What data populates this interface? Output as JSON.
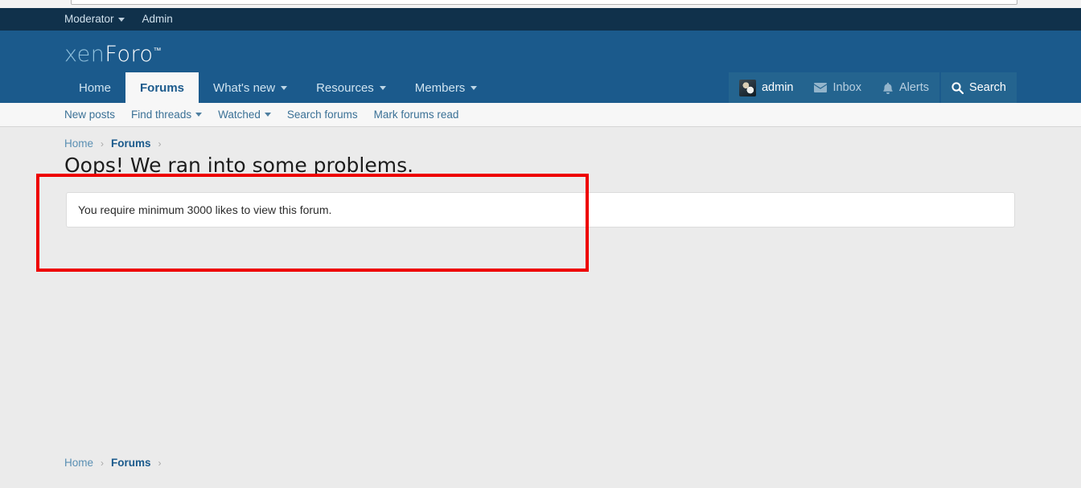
{
  "colors": {
    "staff_bar_bg": "#10314b",
    "header_bg": "#1b5a8c",
    "accent_blue": "#3b7196",
    "annotation_red": "#ee0000",
    "page_bg": "#ebebeb",
    "subnav_bg": "#f7f7f7"
  },
  "staff_bar": {
    "items": [
      {
        "label": "Moderator",
        "has_caret": true
      },
      {
        "label": "Admin",
        "has_caret": false
      }
    ]
  },
  "logo": {
    "part1": "xen",
    "part2": "Foro",
    "trademark": "™"
  },
  "nav": {
    "tabs": [
      {
        "label": "Home",
        "active": false,
        "has_caret": false
      },
      {
        "label": "Forums",
        "active": true,
        "has_caret": false
      },
      {
        "label": "What's new",
        "active": false,
        "has_caret": true
      },
      {
        "label": "Resources",
        "active": false,
        "has_caret": true
      },
      {
        "label": "Members",
        "active": false,
        "has_caret": true
      }
    ]
  },
  "visitor_menu": {
    "username": "admin",
    "avatar_icon": "user-avatar-image",
    "inbox_label": "Inbox",
    "inbox_icon": "envelope-icon",
    "alerts_label": "Alerts",
    "alerts_icon": "bell-icon",
    "search_label": "Search",
    "search_icon": "search-icon"
  },
  "sub_nav": {
    "items": [
      {
        "label": "New posts",
        "has_caret": false
      },
      {
        "label": "Find threads",
        "has_caret": true
      },
      {
        "label": "Watched",
        "has_caret": true
      },
      {
        "label": "Search forums",
        "has_caret": false
      },
      {
        "label": "Mark forums read",
        "has_caret": false
      }
    ]
  },
  "breadcrumb": {
    "items": [
      {
        "label": "Home",
        "strong": false
      },
      {
        "label": "Forums",
        "strong": true
      }
    ],
    "separator": "›"
  },
  "page": {
    "title": "Oops! We ran into some problems.",
    "error_message": "You require minimum 3000 likes to view this forum."
  },
  "annotation": {
    "shape": "rectangle",
    "color": "#ee0000"
  }
}
